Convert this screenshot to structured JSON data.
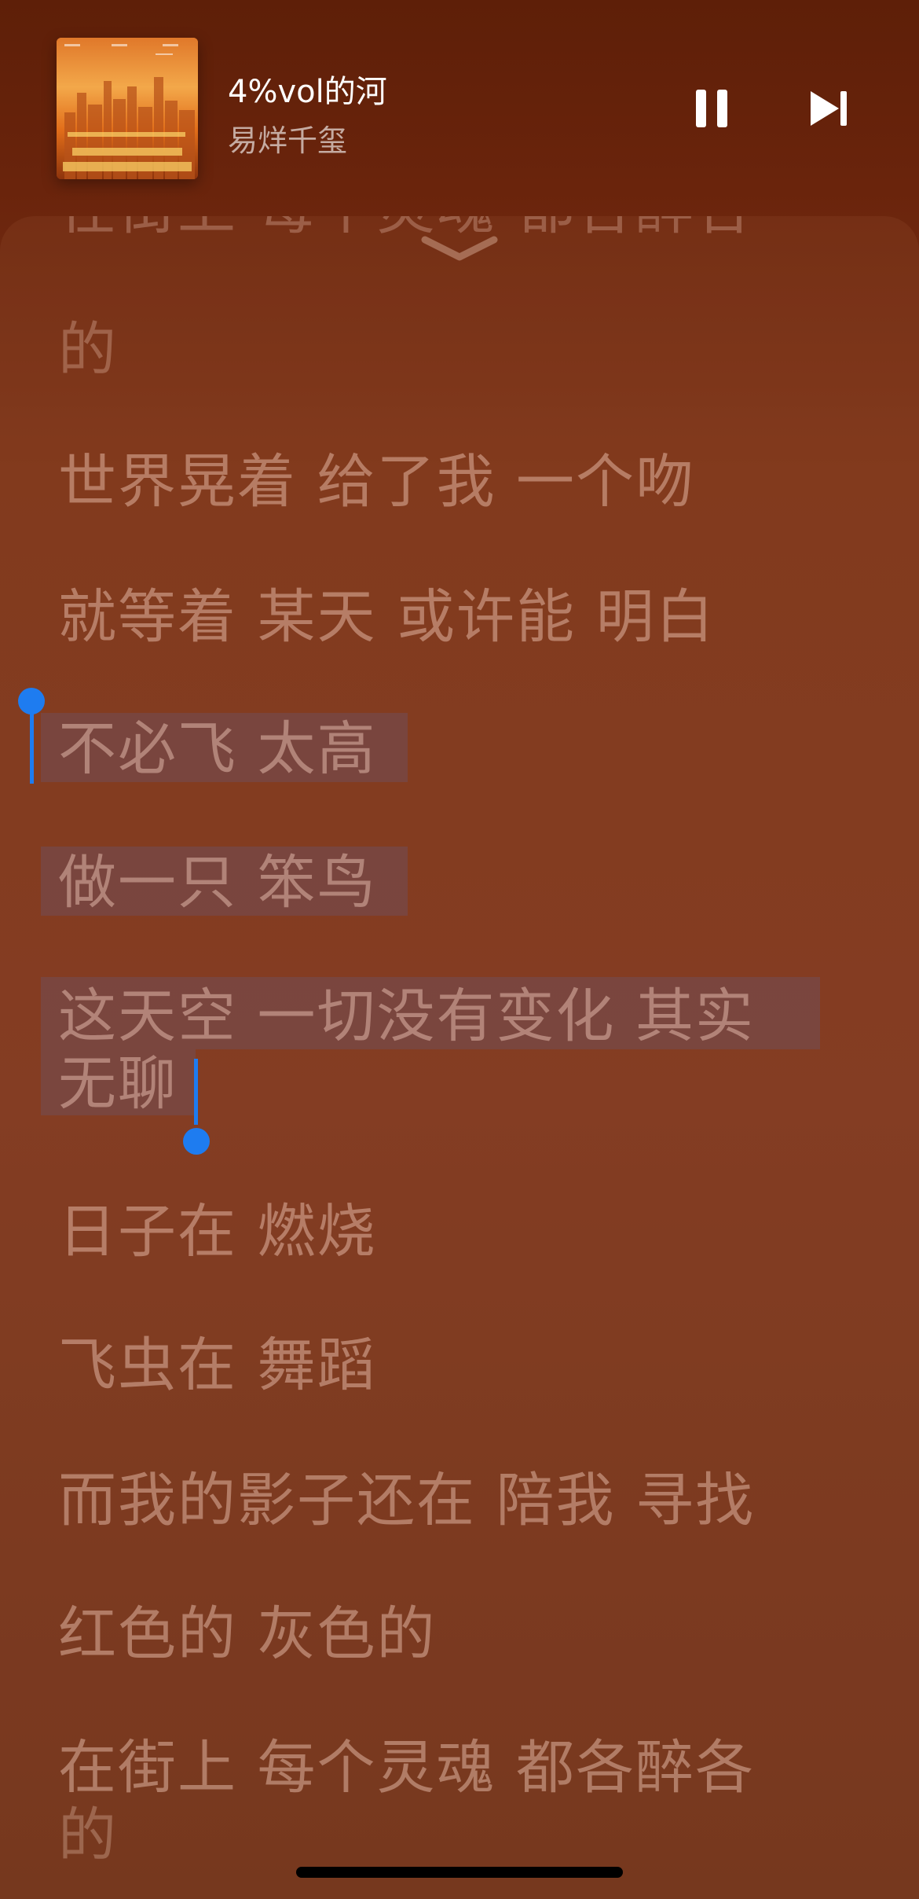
{
  "now_playing": {
    "title": "4%vol的河",
    "artist": "易烊千玺",
    "album_art_icon": "album-cover-city-skyline",
    "pause_icon": "pause-icon",
    "next_icon": "next-track-icon"
  },
  "lyrics": {
    "collapse_icon": "chevron-down-icon",
    "partial_top_line": "在街上 每个灵魂 都各醉各",
    "lines": [
      "的",
      "世界晃着 给了我 一个吻",
      "就等着 某天 或许能 明白",
      "不必飞 太高",
      "做一只 笨鸟",
      "这天空 一切没有变化 其实",
      "无聊",
      "日子在 燃烧",
      "飞虫在 舞蹈",
      "而我的影子还在 陪我 寻找",
      "红色的 灰色的",
      "在街上 每个灵魂 都各醉各",
      "的"
    ],
    "selection_color": "#764a4a",
    "selection_handle_color": "#1e7cf0"
  },
  "colors": {
    "background_top": "#5e1f08",
    "background_mid": "#7f381f",
    "lyric_text": "#ffdac8"
  }
}
